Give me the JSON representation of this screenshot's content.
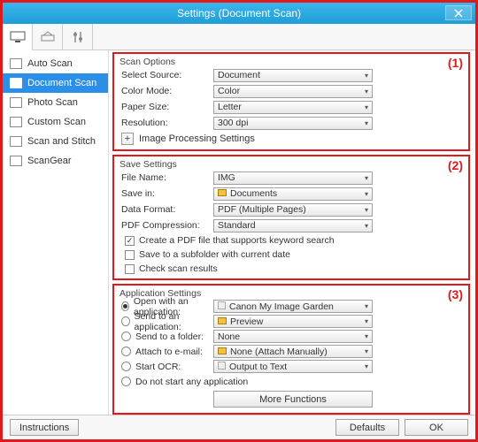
{
  "window": {
    "title": "Settings (Document Scan)"
  },
  "sidebar": {
    "items": [
      {
        "label": "Auto Scan"
      },
      {
        "label": "Document Scan"
      },
      {
        "label": "Photo Scan"
      },
      {
        "label": "Custom Scan"
      },
      {
        "label": "Scan and Stitch"
      },
      {
        "label": "ScanGear"
      }
    ]
  },
  "annotations": {
    "g1": "(1)",
    "g2": "(2)",
    "g3": "(3)"
  },
  "scan_options": {
    "title": "Scan Options",
    "select_source": {
      "label": "Select Source:",
      "value": "Document"
    },
    "color_mode": {
      "label": "Color Mode:",
      "value": "Color"
    },
    "paper_size": {
      "label": "Paper Size:",
      "value": "Letter"
    },
    "resolution": {
      "label": "Resolution:",
      "value": "300 dpi"
    },
    "image_proc": {
      "label": "Image Processing Settings"
    }
  },
  "save_settings": {
    "title": "Save Settings",
    "file_name": {
      "label": "File Name:",
      "value": "IMG"
    },
    "save_in": {
      "label": "Save in:",
      "value": "Documents"
    },
    "data_format": {
      "label": "Data Format:",
      "value": "PDF (Multiple Pages)"
    },
    "pdf_compr": {
      "label": "PDF Compression:",
      "value": "Standard"
    },
    "chk_keyword": "Create a PDF file that supports keyword search",
    "chk_subfold": "Save to a subfolder with current date",
    "chk_check": "Check scan results"
  },
  "app_settings": {
    "title": "Application Settings",
    "open_app": {
      "label": "Open with an application:",
      "value": "Canon My Image Garden"
    },
    "send_app": {
      "label": "Send to an application:",
      "value": "Preview"
    },
    "send_folder": {
      "label": "Send to a folder:",
      "value": "None"
    },
    "attach": {
      "label": "Attach to e-mail:",
      "value": "None (Attach Manually)"
    },
    "ocr": {
      "label": "Start OCR:",
      "value": "Output to Text"
    },
    "no_start": {
      "label": "Do not start any application"
    },
    "more": "More Functions"
  },
  "footer": {
    "instructions": "Instructions",
    "defaults": "Defaults",
    "ok": "OK"
  }
}
